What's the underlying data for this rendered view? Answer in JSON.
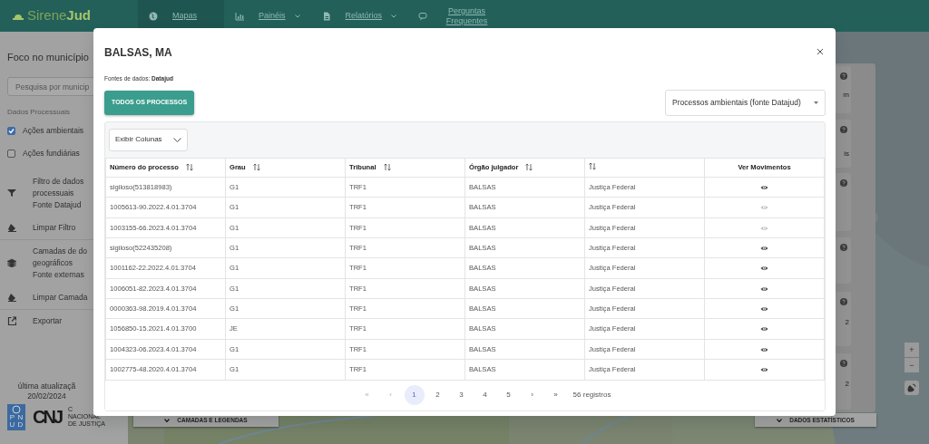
{
  "navbar": {
    "logo": "Sirene**Jud**",
    "items": [
      {
        "label": "Mapas",
        "selected": true,
        "dropdown": false
      },
      {
        "label": "Painéis",
        "selected": false,
        "dropdown": true
      },
      {
        "label": "Relatórios",
        "selected": false,
        "dropdown": true
      },
      {
        "label": "Perguntas Frequentes",
        "selected": false,
        "dropdown": false
      }
    ]
  },
  "sidebar": {
    "title": "Foco no município",
    "search": {
      "placeholder": "Pesquisa por municip"
    },
    "section": "Dados Processuais",
    "checks": [
      {
        "label": "Ações ambientais",
        "checked": true
      },
      {
        "label": "Ações fundiárias",
        "checked": false
      }
    ],
    "actions": [
      {
        "kind": "filter",
        "lines": [
          "Filtro de dados",
          "processuais",
          "Fonte Datajud"
        ]
      },
      {
        "kind": "eraser",
        "lines": [
          "Limpar Filtro"
        ]
      },
      {
        "kind": "layers",
        "lines": [
          "Camadas de do",
          "geográficos",
          "Fonte externas"
        ]
      },
      {
        "kind": "eraser",
        "lines": [
          "Limpar Camada"
        ]
      },
      {
        "kind": "export",
        "lines": [
          "Exportar"
        ]
      }
    ],
    "update_label": "última atualizaçã",
    "update_date": "20/02/2024",
    "pnud": [
      "P",
      "N",
      "U",
      "D"
    ],
    "cnj": "CNJ",
    "cnj_caption": [
      "C",
      "NACIONAL",
      "DE JUSTIÇA"
    ]
  },
  "map": {
    "left_button": "CAMADAS E LEGENDAS",
    "right_button": "DADOS ESTATÍSTICOS",
    "cards": [
      {
        "kind": "value",
        "text": "m"
      },
      {
        "kind": "value",
        "text": "is"
      },
      {
        "kind": "blank"
      },
      {
        "kind": "blank"
      },
      {
        "kind": "value",
        "text": "2"
      },
      {
        "kind": "value",
        "text": "2"
      }
    ],
    "zoom_in": "+",
    "zoom_out": "−"
  },
  "modal": {
    "title": "BALSAS, MA",
    "source": "Fontes de dados: **Datajud**",
    "all_button": "TODOS OS PROCESSOS",
    "select": "Processos ambientais (fonte Datajud)",
    "columns_button": "Exibir Colunas",
    "columns": [
      {
        "label": "Número do processo",
        "sortable": true
      },
      {
        "label": "Grau",
        "sortable": true
      },
      {
        "label": "Tribunal",
        "sortable": true
      },
      {
        "label": "Órgão julgador",
        "sortable": true
      },
      {
        "sortable": true
      },
      {
        "label": "Ver Movimentos",
        "sortable": false
      }
    ],
    "rows": [
      {
        "cells": [
          "sigiloso(513818983)",
          "G1",
          "TRF1",
          "BALSAS",
          "Justiça Federal"
        ],
        "available": true
      },
      {
        "cells": [
          "1005613-90.2022.4.01.3704",
          "G1",
          "TRF1",
          "BALSAS",
          "Justiça Federal"
        ],
        "available": false
      },
      {
        "cells": [
          "1003155-66.2023.4.01.3704",
          "G1",
          "TRF1",
          "BALSAS",
          "Justiça Federal"
        ],
        "available": false
      },
      {
        "cells": [
          "sigiloso(522435208)",
          "G1",
          "TRF1",
          "BALSAS",
          "Justiça Federal"
        ],
        "available": true
      },
      {
        "cells": [
          "1001162-22.2022.4.01.3704",
          "G1",
          "TRF1",
          "BALSAS",
          "Justiça Federal"
        ],
        "available": true
      },
      {
        "cells": [
          "1006051-82.2023.4.01.3704",
          "G1",
          "TRF1",
          "BALSAS",
          "Justiça Federal"
        ],
        "available": true
      },
      {
        "cells": [
          "0000363-98.2019.4.01.3704",
          "G1",
          "TRF1",
          "BALSAS",
          "Justiça Federal"
        ],
        "available": true
      },
      {
        "cells": [
          "1056850-15.2021.4.01.3700",
          "JE",
          "TRF1",
          "BALSAS",
          "Justiça Federal"
        ],
        "available": true
      },
      {
        "cells": [
          "1004323-06.2023.4.01.3704",
          "G1",
          "TRF1",
          "BALSAS",
          "Justiça Federal"
        ],
        "available": true
      },
      {
        "cells": [
          "1002775-48.2020.4.01.3704",
          "G1",
          "TRF1",
          "BALSAS",
          "Justiça Federal"
        ],
        "available": true
      }
    ],
    "pagination": {
      "first": {
        "label": "«",
        "disabled": true
      },
      "prev": {
        "label": "‹",
        "disabled": true
      },
      "pages": [
        {
          "label": "1",
          "selected": true
        },
        {
          "label": "2",
          "selected": false
        },
        {
          "label": "3",
          "selected": false
        },
        {
          "label": "4",
          "selected": false
        },
        {
          "label": "5",
          "selected": false
        }
      ],
      "next": {
        "label": "›",
        "disabled": false
      },
      "last": {
        "label": "»",
        "disabled": false
      },
      "count": "56 registros"
    }
  }
}
